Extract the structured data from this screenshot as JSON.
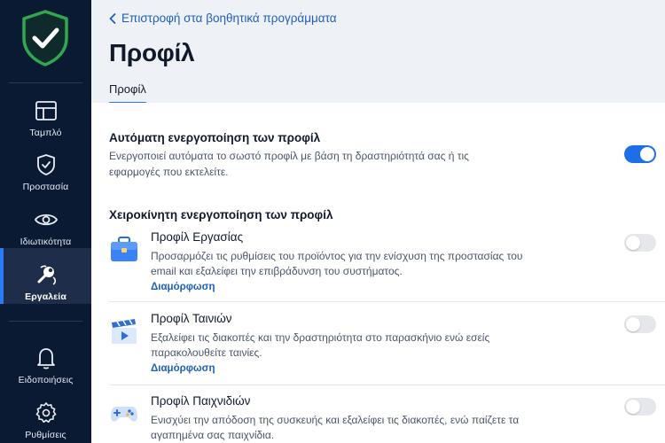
{
  "sidebar": {
    "items": [
      {
        "label": "Ταμπλό",
        "icon": "dashboard-icon"
      },
      {
        "label": "Προστασία",
        "icon": "shield-check-icon"
      },
      {
        "label": "Ιδιωτικότητα",
        "icon": "eye-icon"
      },
      {
        "label": "Εργαλεία",
        "icon": "tools-icon",
        "active": true
      },
      {
        "label": "Ειδοποιήσεις",
        "icon": "bell-icon"
      },
      {
        "label": "Ρυθμίσεις",
        "icon": "gear-icon"
      }
    ]
  },
  "header": {
    "back_link": "Επιστροφή στα βοηθητικά προγράμματα",
    "title": "Προφίλ",
    "tab": "Προφίλ"
  },
  "auto": {
    "title": "Αυτόματη ενεργοποίηση των προφίλ",
    "description": "Ενεργοποιεί αυτόματα το σωστό προφίλ με βάση τη δραστηριότητά σας ή τις εφαρμογές που εκτελείτε.",
    "enabled": true
  },
  "manual": {
    "title": "Χειροκίνητη ενεργοποίηση των προφίλ",
    "profiles": [
      {
        "title": "Προφίλ Εργασίας",
        "description": "Προσαρμόζει τις ρυθμίσεις του προϊόντος για την ενίσχυση της προστασίας του email και εξαλείφει την επιβράδυνση του συστήματος.",
        "link": "Διαμόρφωση",
        "enabled": false,
        "icon": "briefcase-icon"
      },
      {
        "title": "Προφίλ Ταινιών",
        "description": "Εξαλείφει τις διακοπές και την δραστηριότητα στο παρασκήνιο ενώ εσείς παρακολουθείτε ταινίες.",
        "link": "Διαμόρφωση",
        "enabled": false,
        "icon": "clapperboard-icon"
      },
      {
        "title": "Προφίλ Παιχνιδιών",
        "description": "Ενισχύει την απόδοση της συσκευής και εξαλείφει τις διακοπές, ενώ παίζετε τα αγαπημένα σας παιχνίδια.",
        "enabled": false,
        "icon": "gamepad-icon"
      }
    ]
  },
  "colors": {
    "sidebar_bg": "#0b1a33",
    "accent": "#1e6ee8",
    "link": "#1f5fbf",
    "shield_green": "#2fa84f"
  }
}
